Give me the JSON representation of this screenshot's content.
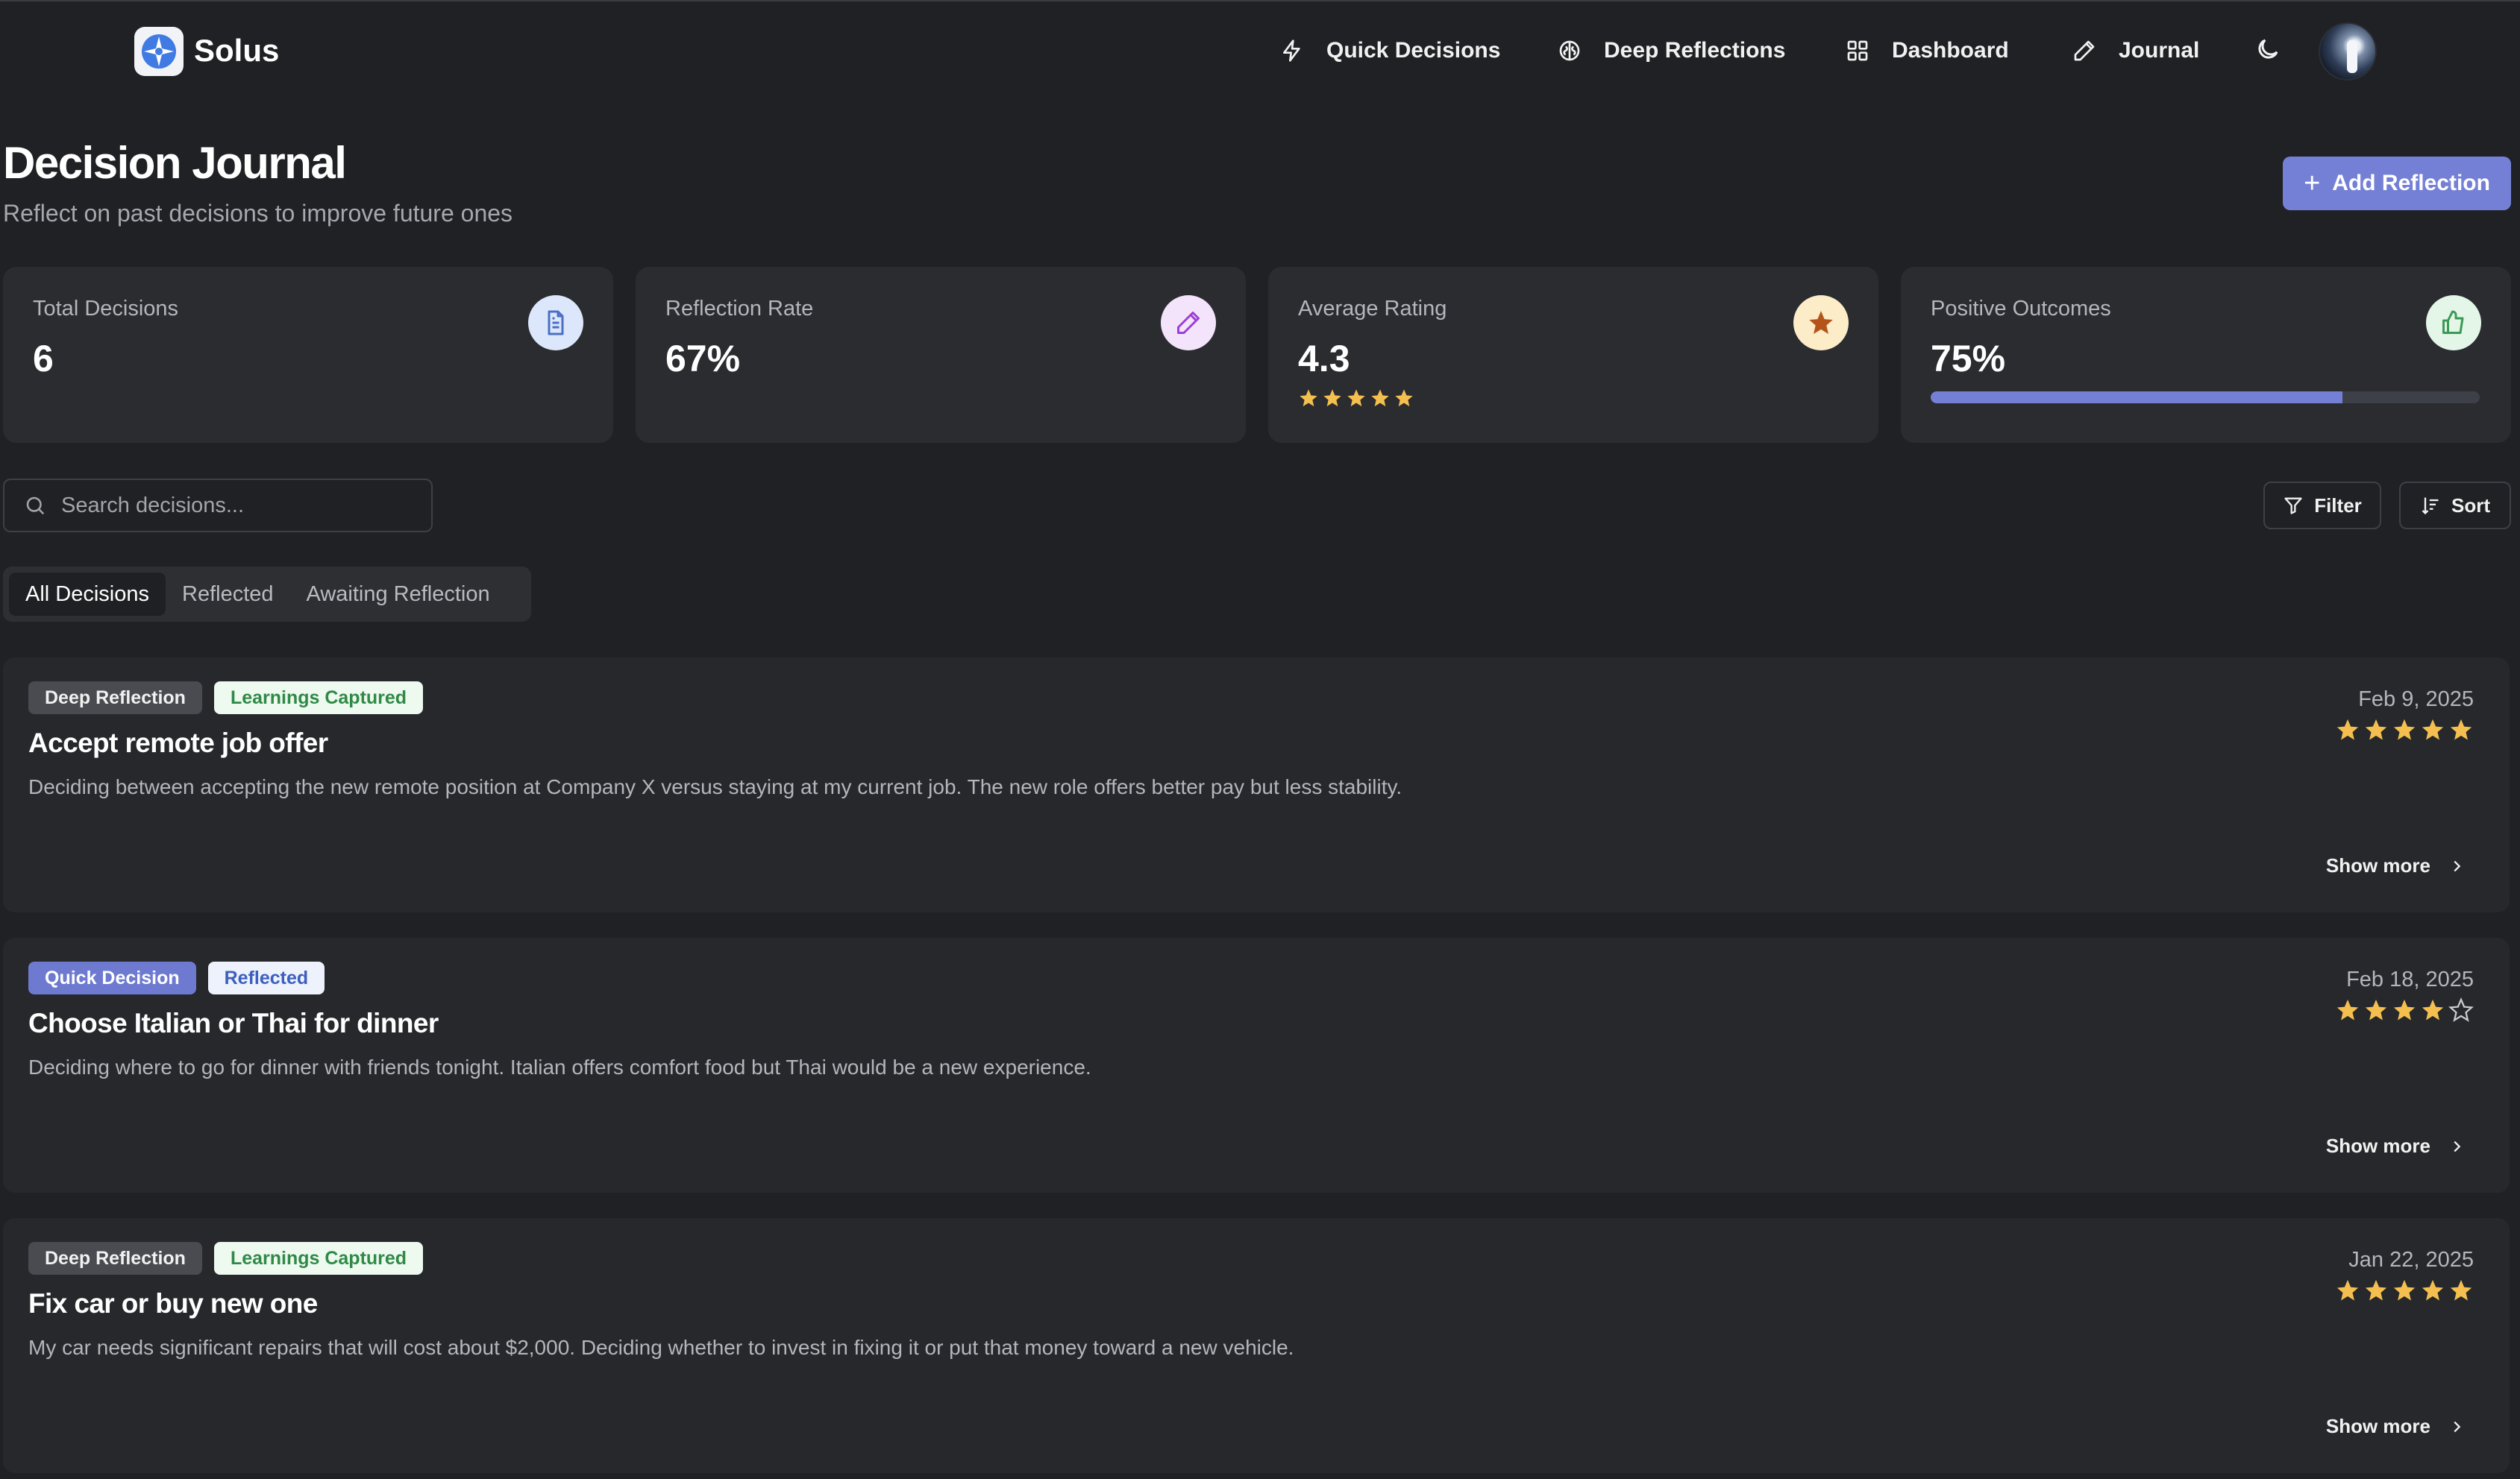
{
  "app": {
    "name": "Solus"
  },
  "nav": [
    {
      "label": "Quick Decisions",
      "icon": "lightning-icon"
    },
    {
      "label": "Deep Reflections",
      "icon": "brain-icon"
    },
    {
      "label": "Dashboard",
      "icon": "grid-icon"
    },
    {
      "label": "Journal",
      "icon": "pencil-icon"
    }
  ],
  "page": {
    "title": "Decision Journal",
    "subtitle": "Reflect on past decisions to improve future ones",
    "add_button": "Add Reflection"
  },
  "stats": [
    {
      "label": "Total Decisions",
      "value": "6",
      "icon": "document-icon",
      "icon_bg": "#dde7fb",
      "icon_color": "#4a6fc4"
    },
    {
      "label": "Reflection Rate",
      "value": "67%",
      "icon": "pencil-icon",
      "icon_bg": "#f3e4fb",
      "icon_color": "#9b3fd6"
    },
    {
      "label": "Average Rating",
      "value": "4.3",
      "icon": "star-icon",
      "icon_bg": "#fcecc8",
      "icon_color": "#b4541b",
      "stars": 5
    },
    {
      "label": "Positive Outcomes",
      "value": "75%",
      "icon": "thumbs-up-icon",
      "icon_bg": "#e3f6e8",
      "icon_color": "#3b9a55",
      "progress": 0.75
    }
  ],
  "search": {
    "placeholder": "Search decisions..."
  },
  "controls": {
    "filter": "Filter",
    "sort": "Sort"
  },
  "tabs": [
    {
      "label": "All Decisions",
      "active": true
    },
    {
      "label": "Reflected",
      "active": false
    },
    {
      "label": "Awaiting Reflection",
      "active": false
    }
  ],
  "decisions": [
    {
      "badges": [
        {
          "text": "Deep Reflection",
          "kind": "deep"
        },
        {
          "text": "Learnings Captured",
          "kind": "learn"
        }
      ],
      "title": "Accept remote job offer",
      "description": "Deciding between accepting the new remote position at Company X versus staying at my current job. The new role offers better pay but less stability.",
      "date": "Feb 9, 2025",
      "rating": 5,
      "show_more": "Show more"
    },
    {
      "badges": [
        {
          "text": "Quick Decision",
          "kind": "quick"
        },
        {
          "text": "Reflected",
          "kind": "refl"
        }
      ],
      "title": "Choose Italian or Thai for dinner",
      "description": "Deciding where to go for dinner with friends tonight. Italian offers comfort food but Thai would be a new experience.",
      "date": "Feb 18, 2025",
      "rating": 4,
      "show_more": "Show more"
    },
    {
      "badges": [
        {
          "text": "Deep Reflection",
          "kind": "deep"
        },
        {
          "text": "Learnings Captured",
          "kind": "learn"
        }
      ],
      "title": "Fix car or buy new one",
      "description": "My car needs significant repairs that will cost about $2,000. Deciding whether to invest in fixing it or put that money toward a new vehicle.",
      "date": "Jan 22, 2025",
      "rating": 5,
      "show_more": "Show more"
    }
  ],
  "colors": {
    "accent": "#7480d6",
    "star": "#f4bf4f",
    "background": "#202124",
    "card": "#2b2c30"
  }
}
